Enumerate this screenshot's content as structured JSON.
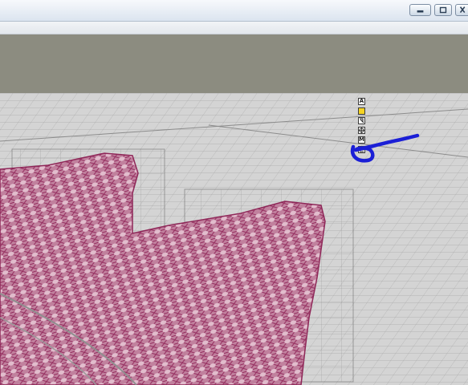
{
  "window": {
    "controls": [
      "minimize-icon",
      "restore-icon",
      "close-icon"
    ]
  },
  "viewport": {
    "background": "#d1d1d1",
    "mesh_color": "#b2386e",
    "grid_color": "#6f6f6f"
  },
  "gizmo": {
    "buttons": [
      {
        "label": "A",
        "icon": "axis-a-icon"
      },
      {
        "label": "",
        "icon": "yellow-square-icon"
      },
      {
        "label": "",
        "icon": "link-icon"
      },
      {
        "label": "",
        "icon": "target-icon"
      },
      {
        "label": "M",
        "icon": "m-icon"
      },
      {
        "label": "",
        "icon": "layer-icon"
      }
    ]
  },
  "annotation": {
    "color": "#1b1fd6"
  }
}
